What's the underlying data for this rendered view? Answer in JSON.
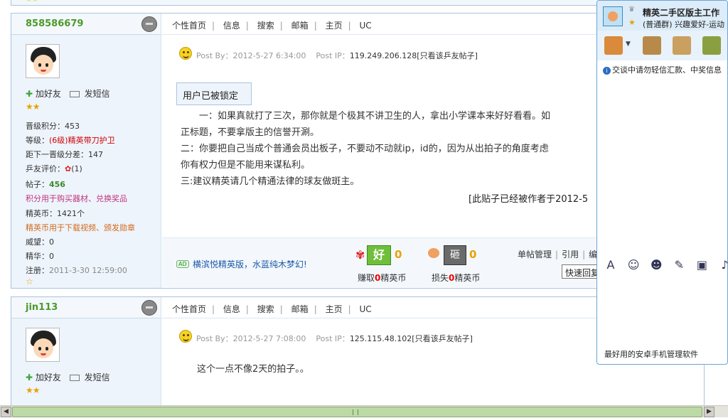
{
  "top_stars": "☆☆",
  "posts": [
    {
      "username": "858586679",
      "nav": [
        "个性首页",
        "信息",
        "搜索",
        "邮箱",
        "主页",
        "UC"
      ],
      "add_friend": "加好友",
      "send_msg": "发短信",
      "stars": "★★",
      "stats": {
        "promo_points_label": "晋级积分：",
        "promo_points_value": "453",
        "level_label": "等级：",
        "level_value": "(6级)精英带刀护卫",
        "next_level": "距下一晋级分差：147",
        "rating_label": "乒友评价：",
        "rating_value": "(1)",
        "posts_label": "帖子：",
        "posts_value": "456",
        "points_note": "积分用于购买器材、兑换奖品",
        "coins": "精英币：1421个",
        "coins_note": "精英币用于下载视频、颁发勋章",
        "prestige": "威望：0",
        "essence": "精华：0",
        "register_label": "注册：",
        "register_value": "2011-3-30 12:59:00"
      },
      "post_by_label": "Post By：",
      "post_time": "2012-5-27 6:34:00",
      "post_ip_label": "Post IP：",
      "post_ip": "119.249.206.128",
      "only_this": "[只看该乒友帖子]",
      "locked": "用户已被锁定",
      "content_lines": [
        "一：如果真就打了三次，那你就是个极其不讲卫生的人，拿出小学课本来好好看看。如",
        "正标题，不要拿版主的信誉开涮。",
        "二：你要把自己当成个普通会员出板子，不要动不动就ip，id的，因为从出拍子的角度考虑",
        "你有权力但是不能用来谋私利。",
        "三:建议精英请几个精通法律的球友做斑主。"
      ],
      "edited_note": "[此贴子已经被作者于2012-5",
      "ad_tag": "AD",
      "ad_text": "横滨悦精英版，水蓝纯木梦幻!",
      "good_label": "好",
      "good_count": "0",
      "earn_label_pre": "赚取",
      "earn_num": "0",
      "earn_label_post": "精英币",
      "bad_label": "砸",
      "bad_count": "0",
      "lose_label_pre": "损失",
      "lose_num": "0",
      "lose_label_post": "精英币",
      "mgmt": [
        "单帖管理",
        "引用",
        "编"
      ],
      "quick_reply": "快速回复..."
    },
    {
      "username": "jin113",
      "nav": [
        "个性首页",
        "信息",
        "搜索",
        "邮箱",
        "主页",
        "UC"
      ],
      "add_friend": "加好友",
      "send_msg": "发短信",
      "stars": "★★",
      "post_by_label": "Post By：",
      "post_time": "2012-5-27 7:08:00",
      "post_ip_label": "Post IP：",
      "post_ip": "125.115.48.102",
      "only_this": "[只看该乒友帖子]",
      "content": "这个一点不像2天的拍子。。"
    }
  ],
  "qq": {
    "title": "精英二手区版主工作",
    "subtitle": "(普通群) 兴趣爱好-运动",
    "notice": "交谈中请勿轻信汇款、中奖信息",
    "ad": "最好用的安卓手机管理软件"
  }
}
